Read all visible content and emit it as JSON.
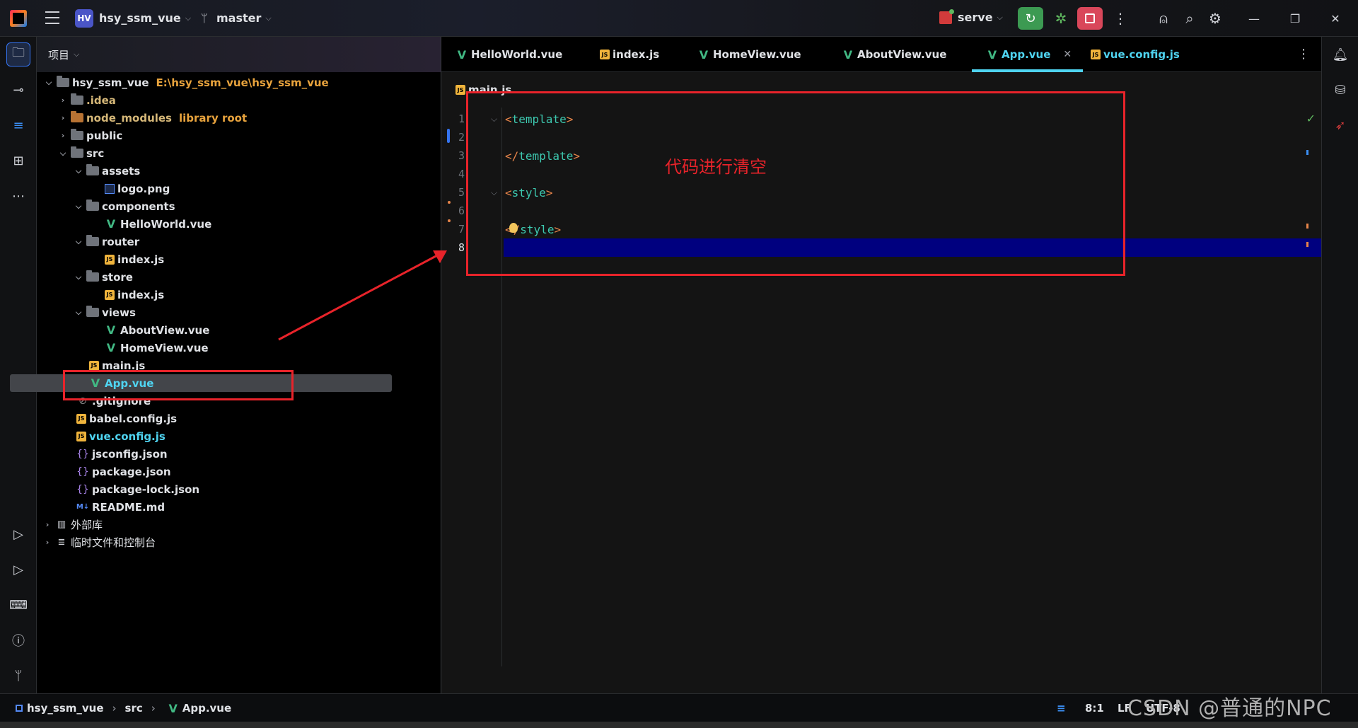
{
  "titlebar": {
    "project_badge": "HV",
    "project_name": "hsy_ssm_vue",
    "branch": "master",
    "run_config": "serve"
  },
  "panel": {
    "title": "项目"
  },
  "tree": {
    "root_name": "hsy_ssm_vue",
    "root_path": "E:\\hsy_ssm_vue\\hsy_ssm_vue",
    "idea": ".idea",
    "node_modules": "node_modules",
    "library_root": "library root",
    "public": "public",
    "src": "src",
    "assets": "assets",
    "logo": "logo.png",
    "components": "components",
    "helloworld": "HelloWorld.vue",
    "router": "router",
    "router_index": "index.js",
    "store": "store",
    "store_index": "index.js",
    "views": "views",
    "aboutview": "AboutView.vue",
    "homeview": "HomeView.vue",
    "mainjs": "main.js",
    "appvue": "App.vue",
    "gitignore": ".gitignore",
    "babel": "babel.config.js",
    "vueconfig": "vue.config.js",
    "jsconfig": "jsconfig.json",
    "package": "package.json",
    "packagelock": "package-lock.json",
    "readme": "README.md",
    "external_libs": "外部库",
    "scratches": "临时文件和控制台"
  },
  "tabs": [
    {
      "label": "HelloWorld.vue",
      "icon": "vue-icon"
    },
    {
      "label": "index.js",
      "icon": "js-icon"
    },
    {
      "label": "HomeView.vue",
      "icon": "vue-icon"
    },
    {
      "label": "AboutView.vue",
      "icon": "vue-icon"
    },
    {
      "label": "App.vue",
      "icon": "vue-icon",
      "active": true
    },
    {
      "label": "vue.config.js",
      "icon": "js-icon"
    }
  ],
  "editor": {
    "breadcrumb_file": "main.js",
    "line_numbers": [
      "1",
      "2",
      "3",
      "4",
      "5",
      "6",
      "7",
      "8"
    ],
    "code": {
      "l1_open": "<",
      "l1_tag": "template",
      "l1_close": ">",
      "l3_open": "</",
      "l3_tag": "template",
      "l3_close": ">",
      "l5_open": "<",
      "l5_tag": "style",
      "l5_close": ">",
      "l7_open": "<",
      "l7_slash": "/",
      "l7_tag": "style",
      "l7_close": ">"
    },
    "annotation": "代码进行清空"
  },
  "statusbar": {
    "crumb_project": "hsy_ssm_vue",
    "crumb_src": "src",
    "crumb_file": "App.vue",
    "position": "8:1",
    "line_sep": "LF",
    "encoding": "UTF-8",
    "watermark": "CSDN @普通的NPC"
  },
  "colors": {
    "accent": "#4fd4f1",
    "annotation": "#e8232a",
    "current_line": "#00007f",
    "run_green": "#3c9a52",
    "stop_red": "#d9475a"
  }
}
